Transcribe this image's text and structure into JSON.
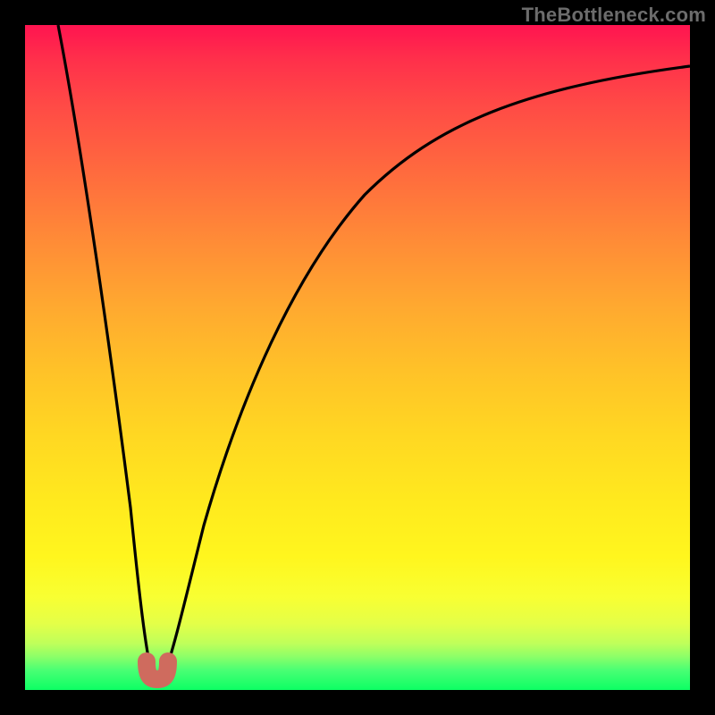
{
  "watermark": "TheBottleneck.com",
  "colors": {
    "frame": "#000000",
    "gradient_top": "#ff1450",
    "gradient_bottom": "#0cff64",
    "curve": "#000000",
    "bump": "#cf6b5e",
    "watermark": "#6c6c6c"
  },
  "chart_data": {
    "type": "line",
    "title": "",
    "xlabel": "",
    "ylabel": "",
    "xlim": [
      0,
      100
    ],
    "ylim": [
      0,
      100
    ],
    "grid": false,
    "legend": false,
    "note": "Values approximate the black bottleneck curve. y=100 at top (red), y=0 at bottom (green). Minimum near x≈19.",
    "series": [
      {
        "name": "bottleneck-curve",
        "x": [
          5,
          6,
          8,
          10,
          12,
          14,
          16,
          17,
          18,
          19,
          20,
          21,
          22,
          24,
          28,
          32,
          36,
          40,
          45,
          50,
          55,
          60,
          65,
          70,
          75,
          80,
          85,
          90,
          95,
          100
        ],
        "y": [
          100,
          92,
          77,
          63,
          49,
          36,
          22,
          15,
          8,
          2,
          3,
          9,
          15,
          25,
          40,
          51,
          59,
          65,
          72,
          77,
          81,
          84,
          86,
          88,
          90,
          91,
          92,
          93,
          93.5,
          94
        ]
      }
    ],
    "marker": {
      "name": "optimum-bump",
      "x": 19,
      "y": 2
    }
  }
}
